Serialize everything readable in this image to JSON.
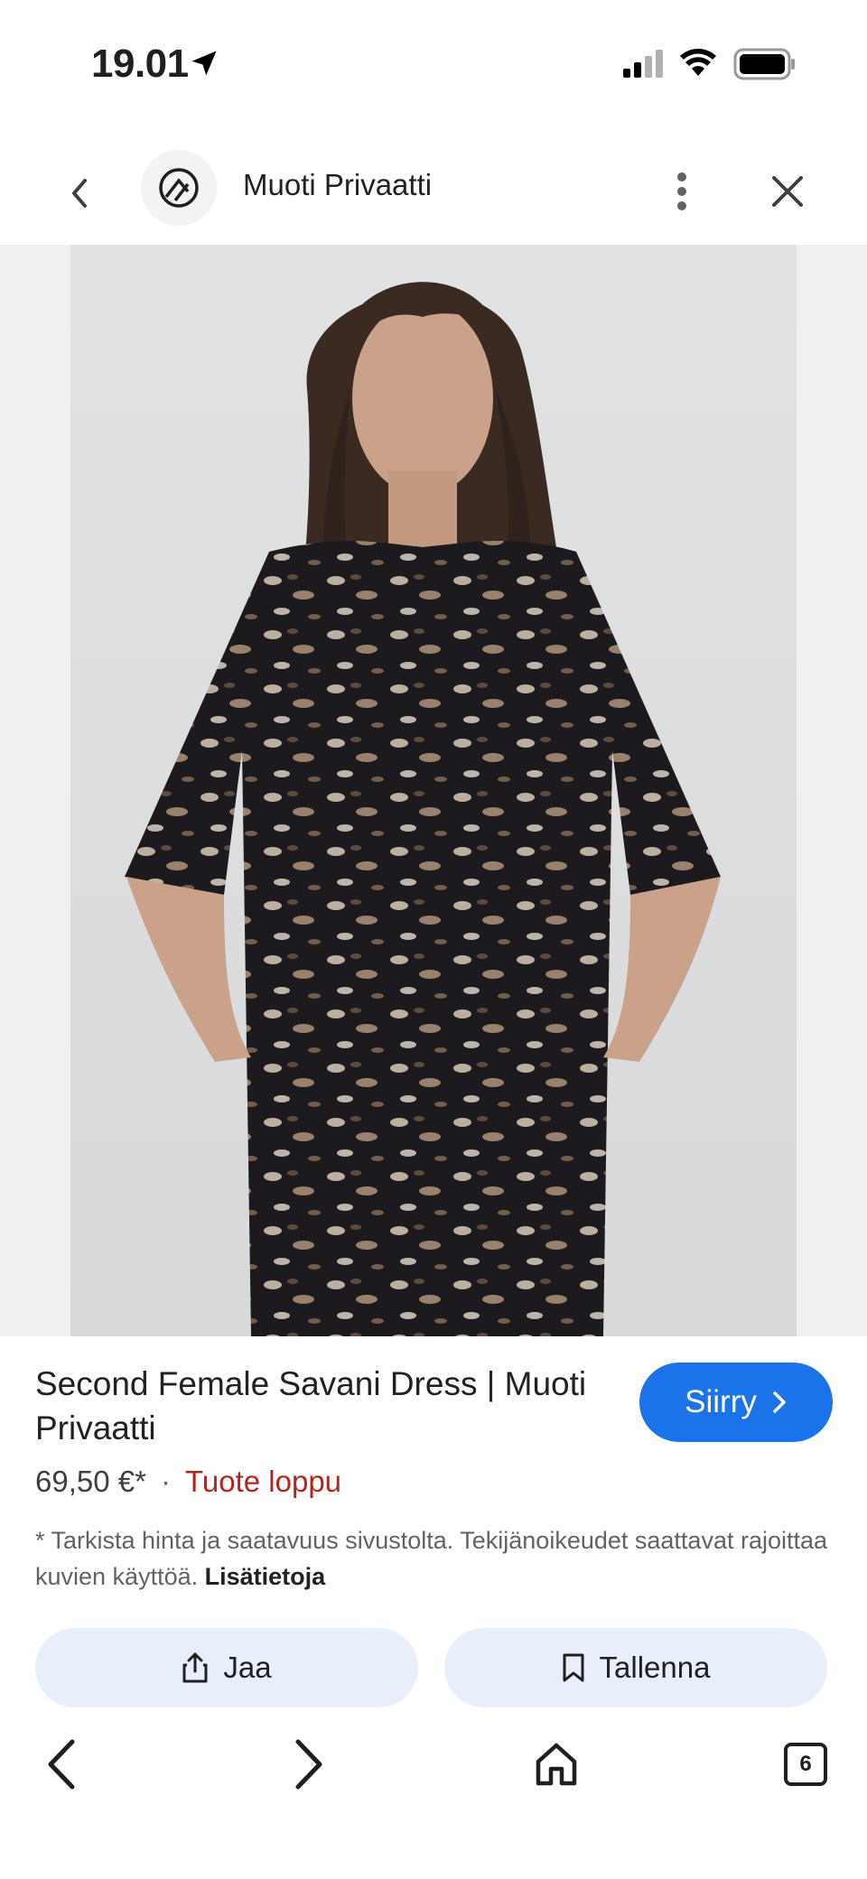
{
  "status_bar": {
    "time": "19.01",
    "icons": [
      "location-arrow-icon",
      "signal-icon",
      "wifi-icon",
      "battery-icon"
    ]
  },
  "header": {
    "site_name": "Muoti Privaatti",
    "icons": [
      "back-icon",
      "site-logo-icon",
      "more-vert-icon",
      "close-icon"
    ]
  },
  "product": {
    "title": "Second Female Savani Dress | Muoti Privaatti",
    "go_label": "Siirry",
    "price": "69,50 €*",
    "separator": "·",
    "stock": "Tuote loppu",
    "disclaimer": "* Tarkista hinta ja saatavuus sivustolta. Tekijänoikeudet saattavat rajoittaa kuvien käyttöä.",
    "more_info": "Lisätietoja",
    "share_label": "Jaa",
    "save_label": "Tallenna"
  },
  "bottom_nav": {
    "tabs_count": "6",
    "icons": [
      "back-arrow-icon",
      "forward-arrow-icon",
      "home-icon",
      "tabs-icon"
    ]
  },
  "colors": {
    "accent": "#1a73e8",
    "stock_red": "#b3261e",
    "chip_bg": "#e8effa"
  }
}
